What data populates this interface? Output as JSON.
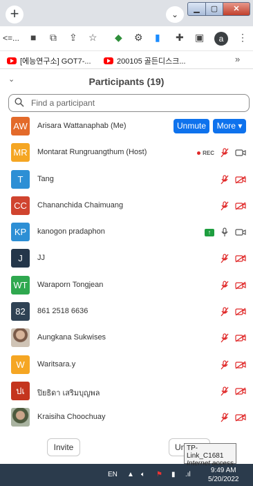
{
  "browser": {
    "url_fragment": "<=...",
    "profile_initial": "a",
    "bookmarks": [
      {
        "label": "[에능연구소] GOT7-..."
      },
      {
        "label": "200105 골든디스크..."
      }
    ],
    "bookmarks_more": "»"
  },
  "panel": {
    "title": "Participants (19)",
    "search_placeholder": "Find a participant"
  },
  "participants": [
    {
      "initials": "AW",
      "name": "Arisara Wattanaphab (Me)",
      "color": "#e36a2a",
      "unmute_label": "Unmute",
      "more_label": "More ▾"
    },
    {
      "initials": "MR",
      "name": "Montarat Rungruangthum (Host)",
      "color": "#f5a623",
      "rec_label": "REC"
    },
    {
      "initials": "T",
      "name": "Tang",
      "color": "#2d8fd5"
    },
    {
      "initials": "CC",
      "name": "Chananchida Chaimuang",
      "color": "#d0442f"
    },
    {
      "initials": "KP",
      "name": "kanogon pradaphon",
      "color": "#2d8fd5"
    },
    {
      "initials": "J",
      "name": "JJ",
      "color": "#24364a"
    },
    {
      "initials": "WT",
      "name": "Waraporn Tongjean",
      "color": "#2fa84f"
    },
    {
      "initials": "82",
      "name": "861 2518 6636",
      "color": "#2f4254"
    },
    {
      "initials": "",
      "name": "Aungkana Sukwises",
      "color": "#b08a70"
    },
    {
      "initials": "W",
      "name": "Waritsara.y",
      "color": "#f5a623"
    },
    {
      "initials": "ปเ",
      "name": "ปิยธิดา เสริมบุญพล",
      "color": "#c4351e"
    },
    {
      "initials": "",
      "name": "Kraisiha Choochuay",
      "color": "#6e7a5e"
    }
  ],
  "footer": {
    "invite_label": "Invite",
    "unmute_all_label": "Un"
  },
  "tooltip": {
    "line1": "TP-Link_C1681",
    "line2": "Internet access"
  },
  "taskbar": {
    "language": "EN",
    "time": "9:49 AM",
    "date": "5/20/2022"
  }
}
